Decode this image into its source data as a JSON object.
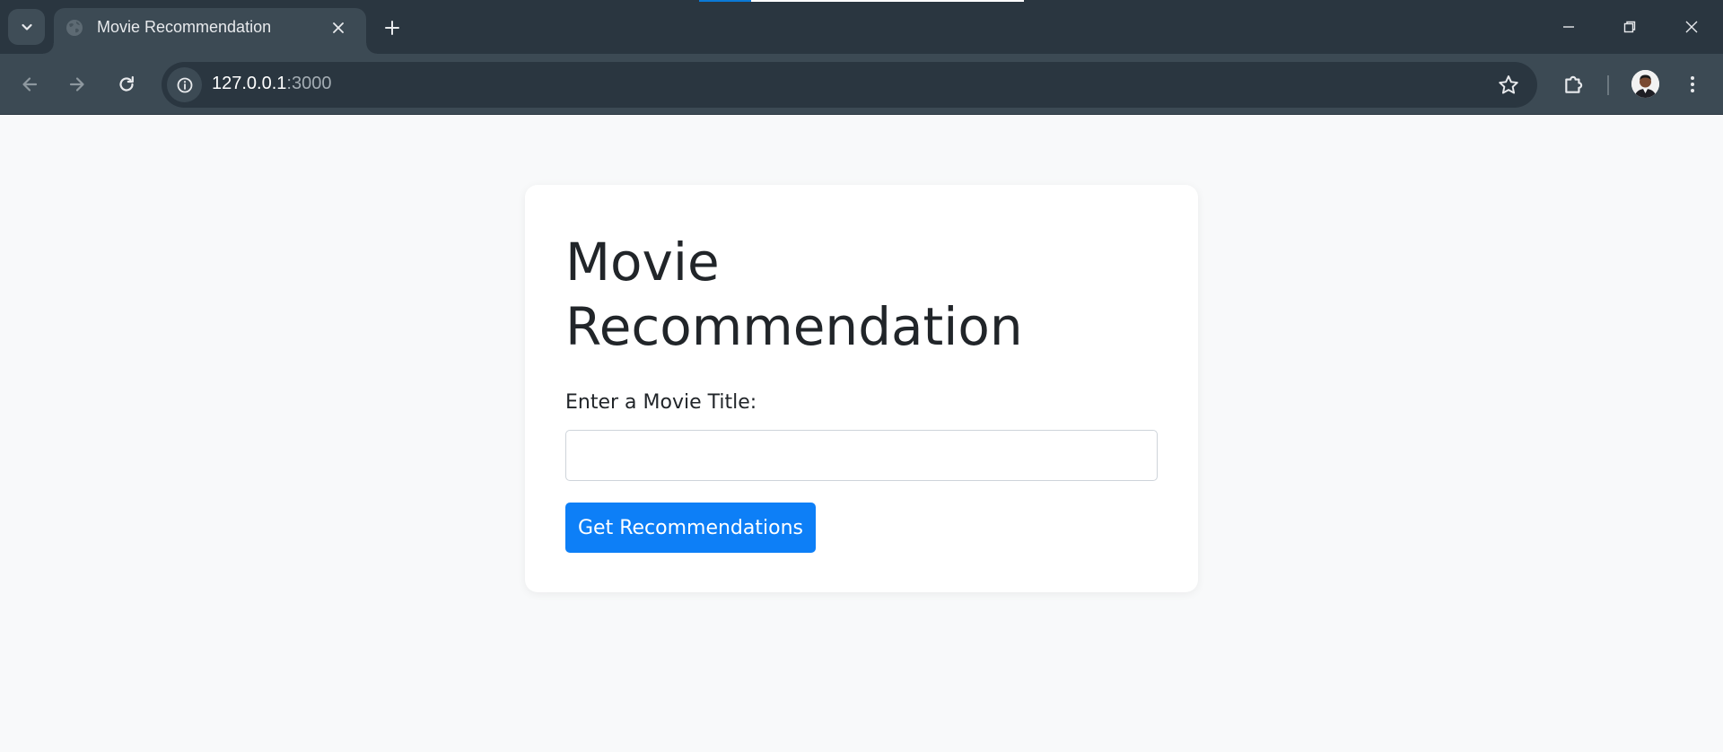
{
  "browser": {
    "tab": {
      "title": "Movie Recommendation",
      "favicon": "globe-icon"
    },
    "url": {
      "host": "127.0.0.1",
      "port": ":3000"
    },
    "load_progress": 0.16,
    "icons": {
      "tab_search": "chevron-down-icon",
      "close_tab": "close-icon",
      "new_tab": "plus-icon",
      "minimize": "minimize-icon",
      "restore": "restore-icon",
      "close_window": "close-icon",
      "back": "arrow-left-icon",
      "forward": "arrow-right-icon",
      "reload": "reload-icon",
      "site_info": "info-icon",
      "bookmark": "star-icon",
      "extensions": "puzzle-icon",
      "profile": "avatar",
      "menu": "kebab-menu-icon"
    },
    "colors": {
      "tabstrip": "#2a3640",
      "toolbar": "#3c4a54",
      "progress": "#0b79d6"
    }
  },
  "page": {
    "title": "Movie Recommendation",
    "form": {
      "label": "Enter a Movie Title:",
      "input_value": "",
      "input_placeholder": "",
      "submit_label": "Get Recommendations"
    },
    "colors": {
      "background": "#f8f9fa",
      "card": "#ffffff",
      "primary_button": "#0d7ff7",
      "text": "#212529"
    }
  }
}
